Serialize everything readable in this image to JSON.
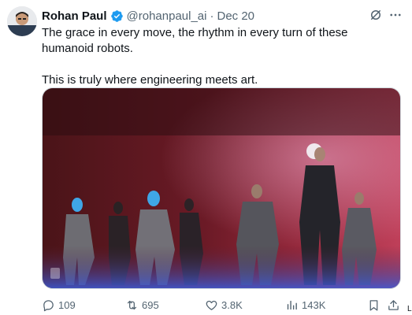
{
  "author": {
    "name": "Rohan Paul",
    "handle": "@rohanpaul_ai",
    "separator": "·",
    "date": "Dec 20",
    "verified_color": "#1d9bf0"
  },
  "tweet": {
    "line1": "The grace in every move, the rhythm in every turn of these humanoid robots.",
    "line2": "This is truly where engineering meets art."
  },
  "media": {
    "kind": "video-still",
    "subject": "performers dancing on a red-lit stage"
  },
  "actions": {
    "replies": "109",
    "reposts": "695",
    "likes": "3.8K",
    "views": "143K"
  },
  "icons": [
    "grok-icon",
    "more-icon",
    "reply-icon",
    "repost-icon",
    "like-icon",
    "views-icon",
    "bookmark-icon",
    "share-icon",
    "verified-badge-icon"
  ],
  "edge_mark": "L",
  "colors": {
    "text_primary": "#0f1419",
    "text_secondary": "#536471",
    "accent": "#1d9bf0"
  }
}
